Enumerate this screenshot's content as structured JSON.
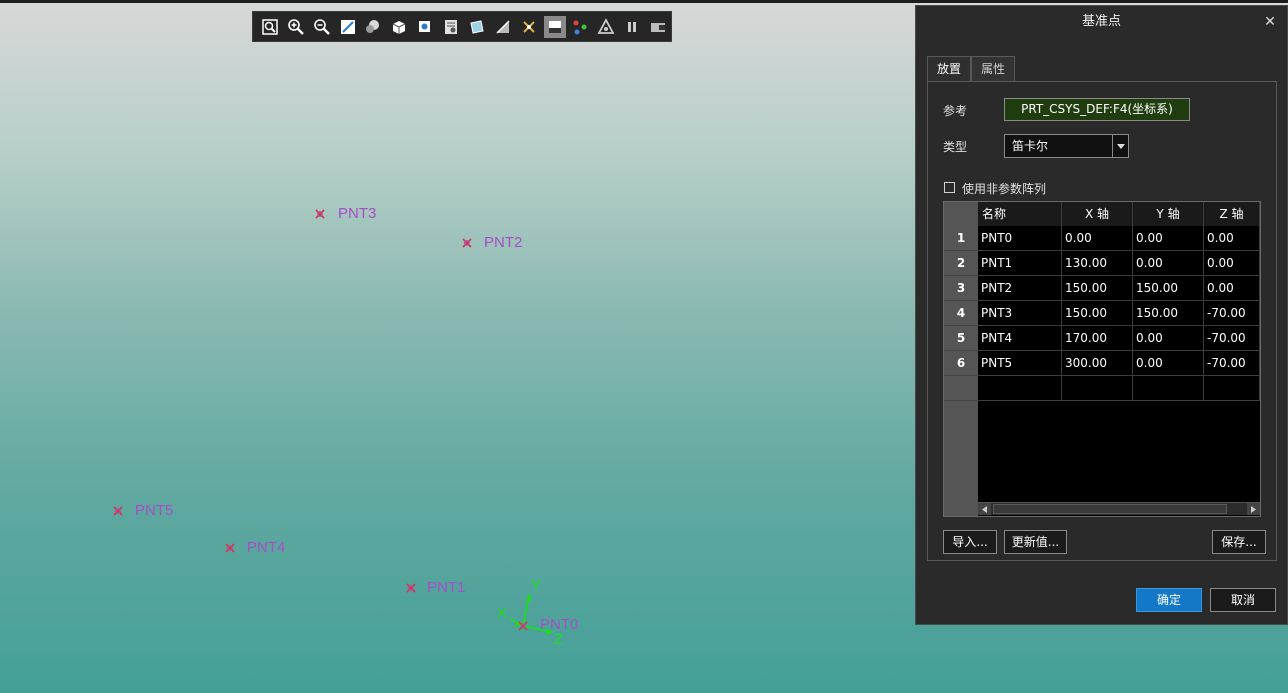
{
  "toolbar": {
    "icons": [
      "refit-icon",
      "zoom-in-icon",
      "zoom-out-icon",
      "repaint-icon",
      "shading-icon",
      "view-manager-icon",
      "saved-views-icon",
      "display-style-icon",
      "perspective-icon",
      "section-icon",
      "datum-display-icon",
      "annotation-icon",
      "spin-center-icon",
      "appearance-icon",
      "pause-icon",
      "animation-icon"
    ]
  },
  "viewport": {
    "points": [
      {
        "name": "PNT3"
      },
      {
        "name": "PNT2"
      },
      {
        "name": "PNT5"
      },
      {
        "name": "PNT4"
      },
      {
        "name": "PNT1"
      },
      {
        "name": "PNT0"
      }
    ],
    "axes": {
      "x": "X",
      "y": "Y",
      "z": "Z"
    }
  },
  "dialog": {
    "title": "基准点",
    "tabs": [
      "放置",
      "属性"
    ],
    "reference_label": "参考",
    "reference_value": "PRT_CSYS_DEF:F4(坐标系)",
    "type_label": "类型",
    "type_value": "笛卡尔",
    "nonparam_label": "使用非参数阵列",
    "table": {
      "headers": [
        "名称",
        "X 轴",
        "Y 轴",
        "Z 轴"
      ],
      "rows": [
        {
          "index": "1",
          "name": "PNT0",
          "x": "0.00",
          "y": "0.00",
          "z": "0.00"
        },
        {
          "index": "2",
          "name": "PNT1",
          "x": "130.00",
          "y": "0.00",
          "z": "0.00"
        },
        {
          "index": "3",
          "name": "PNT2",
          "x": "150.00",
          "y": "150.00",
          "z": "0.00"
        },
        {
          "index": "4",
          "name": "PNT3",
          "x": "150.00",
          "y": "150.00",
          "z": "-70.00"
        },
        {
          "index": "5",
          "name": "PNT4",
          "x": "170.00",
          "y": "0.00",
          "z": "-70.00"
        },
        {
          "index": "6",
          "name": "PNT5",
          "x": "300.00",
          "y": "0.00",
          "z": "-70.00"
        }
      ]
    },
    "buttons": {
      "import": "导入...",
      "update": "更新值...",
      "save": "保存...",
      "ok": "确定",
      "cancel": "取消"
    }
  }
}
